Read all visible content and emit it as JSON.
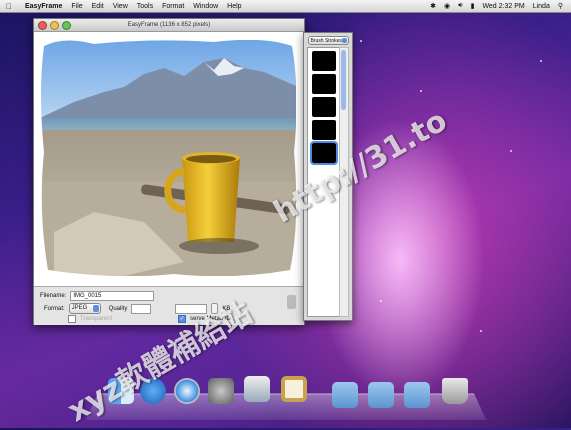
{
  "menubar": {
    "app": "EasyFrame",
    "items": [
      "File",
      "Edit",
      "View",
      "Tools",
      "Format",
      "Window",
      "Help"
    ],
    "clock": "Wed 2:32 PM",
    "user": "Linda"
  },
  "window": {
    "title": "EasyFrame (1136 x 852 pixels)",
    "filename_label": "Filename:",
    "filename": "IMG_0015",
    "format_label": "Format:",
    "format": "JPEG",
    "quality_label": "Quality",
    "kb_label": "KB",
    "transparent_label": "Transparent",
    "metadata_label": "serve Metadata"
  },
  "panel": {
    "category": "Brush Strokes"
  },
  "watermark": {
    "url": "http://31.to",
    "text": "xyz軟體補給站"
  }
}
